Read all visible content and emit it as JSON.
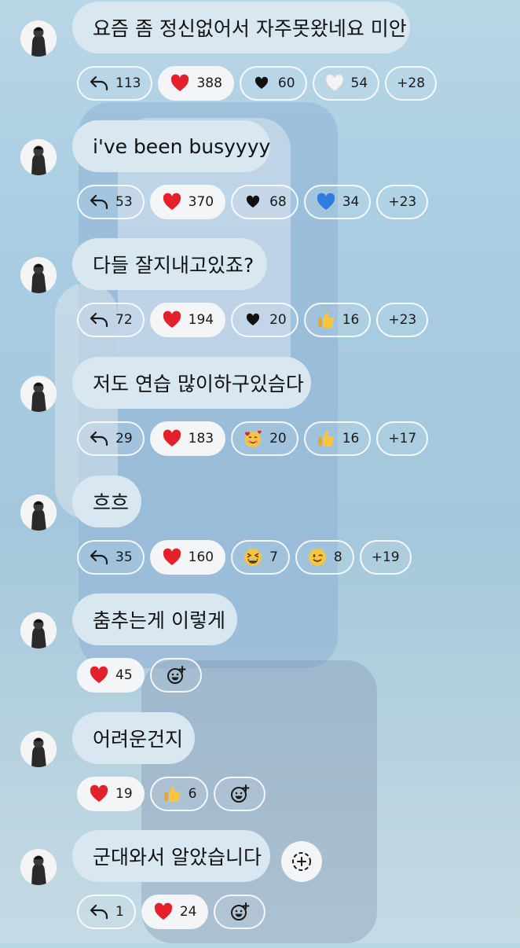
{
  "messages": [
    {
      "text": "요즘 좀 정신없어서 자주못왔네요 미안",
      "reactions": [
        {
          "icon": "reply-icon",
          "count": "113"
        },
        {
          "icon": "red-heart-icon",
          "count": "388",
          "selected": true
        },
        {
          "icon": "black-heart-icon",
          "count": "60"
        },
        {
          "icon": "white-heart-icon",
          "count": "54"
        },
        {
          "icon": "",
          "count": "+28"
        }
      ]
    },
    {
      "text": "i've been busyyyy",
      "reactions": [
        {
          "icon": "reply-icon",
          "count": "53"
        },
        {
          "icon": "red-heart-icon",
          "count": "370",
          "selected": true
        },
        {
          "icon": "black-heart-icon",
          "count": "68"
        },
        {
          "icon": "blue-heart-icon",
          "count": "34"
        },
        {
          "icon": "",
          "count": "+23"
        }
      ]
    },
    {
      "text": "다들 잘지내고있죠?",
      "reactions": [
        {
          "icon": "reply-icon",
          "count": "72"
        },
        {
          "icon": "red-heart-icon",
          "count": "194",
          "selected": true
        },
        {
          "icon": "black-heart-icon",
          "count": "20"
        },
        {
          "icon": "thumbs-up-icon",
          "count": "16"
        },
        {
          "icon": "",
          "count": "+23"
        }
      ]
    },
    {
      "text": "저도 연습 많이하구있슴다",
      "reactions": [
        {
          "icon": "reply-icon",
          "count": "29"
        },
        {
          "icon": "red-heart-icon",
          "count": "183",
          "selected": true
        },
        {
          "icon": "smiling-face-with-hearts-icon",
          "count": "20"
        },
        {
          "icon": "thumbs-up-icon",
          "count": "16"
        },
        {
          "icon": "",
          "count": "+17"
        }
      ]
    },
    {
      "text": "흐흐",
      "reactions": [
        {
          "icon": "reply-icon",
          "count": "35"
        },
        {
          "icon": "red-heart-icon",
          "count": "160",
          "selected": true
        },
        {
          "icon": "grinning-squinting-face-icon",
          "count": "7"
        },
        {
          "icon": "winking-face-icon",
          "count": "8"
        },
        {
          "icon": "",
          "count": "+19"
        }
      ]
    },
    {
      "text": "춤추는게 이렇게",
      "reactions": [
        {
          "icon": "red-heart-icon",
          "count": "45",
          "selected": true
        },
        {
          "icon": "add-reaction-icon",
          "count": ""
        }
      ]
    },
    {
      "text": "어려운건지",
      "reactions": [
        {
          "icon": "red-heart-icon",
          "count": "19",
          "selected": true
        },
        {
          "icon": "thumbs-up-icon",
          "count": "6"
        },
        {
          "icon": "add-reaction-icon",
          "count": ""
        }
      ]
    },
    {
      "text": "군대와서 알았습니다",
      "side_button_icon": "add-circle-dashed-icon",
      "reactions": [
        {
          "icon": "reply-icon",
          "count": "1"
        },
        {
          "icon": "red-heart-icon",
          "count": "24",
          "selected": true
        },
        {
          "icon": "add-reaction-icon",
          "count": ""
        }
      ]
    }
  ]
}
